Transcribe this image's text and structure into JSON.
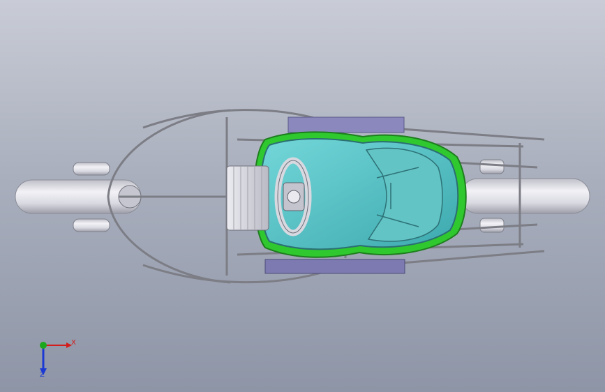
{
  "viewport": {
    "background_top": "#c9ccd6",
    "background_bottom": "#8e95a6"
  },
  "model": {
    "view": "top",
    "parts": [
      "rear-axle",
      "front-axle",
      "chassis-frame",
      "seat",
      "steering-wheel",
      "steering-column-housing",
      "side-pod-top",
      "side-pod-bottom"
    ],
    "colors": {
      "seat": "#5fc7c9",
      "seat_trim": "#2fc92f",
      "frame": "#8e8e92",
      "axle": "#d4d4dc",
      "side_pod": "#7c7ab0"
    }
  },
  "triad": {
    "x_label": "X",
    "z_label": "Z",
    "x_color": "#d31c1c",
    "y_color": "#1ca81c",
    "z_color": "#1c3ad3"
  }
}
